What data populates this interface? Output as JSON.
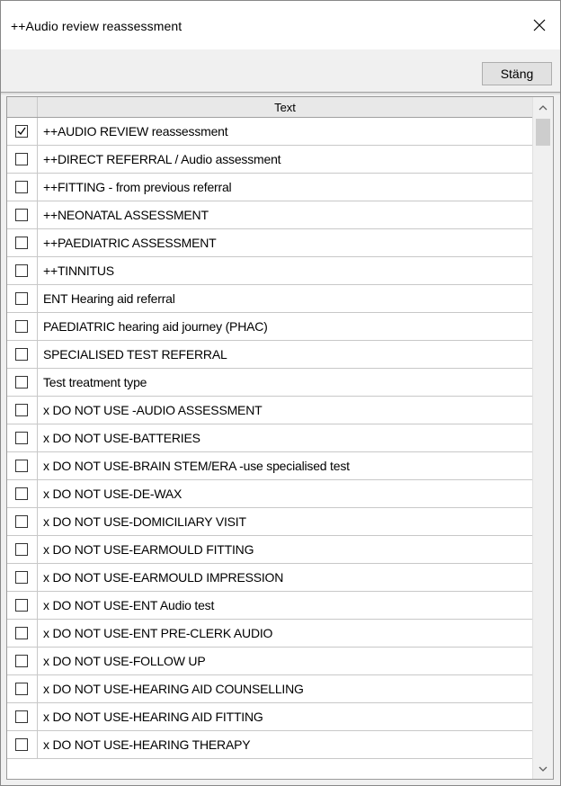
{
  "window": {
    "title": "++Audio review reassessment"
  },
  "toolbar": {
    "close_label": "Stäng"
  },
  "grid": {
    "column_header": "Text",
    "rows": [
      {
        "label": "++AUDIO REVIEW reassessment",
        "checked": true
      },
      {
        "label": "++DIRECT REFERRAL / Audio assessment",
        "checked": false
      },
      {
        "label": "++FITTING - from previous referral",
        "checked": false
      },
      {
        "label": "++NEONATAL ASSESSMENT",
        "checked": false
      },
      {
        "label": "++PAEDIATRIC ASSESSMENT",
        "checked": false
      },
      {
        "label": "++TINNITUS",
        "checked": false
      },
      {
        "label": "ENT Hearing aid referral",
        "checked": false
      },
      {
        "label": "PAEDIATRIC hearing aid journey (PHAC)",
        "checked": false
      },
      {
        "label": "SPECIALISED TEST REFERRAL",
        "checked": false
      },
      {
        "label": "Test treatment type",
        "checked": false
      },
      {
        "label": "x DO NOT USE -AUDIO ASSESSMENT",
        "checked": false
      },
      {
        "label": "x DO NOT USE-BATTERIES",
        "checked": false
      },
      {
        "label": "x DO NOT USE-BRAIN STEM/ERA -use specialised test",
        "checked": false
      },
      {
        "label": "x DO NOT USE-DE-WAX",
        "checked": false
      },
      {
        "label": "x DO NOT USE-DOMICILIARY VISIT",
        "checked": false
      },
      {
        "label": "x DO NOT USE-EARMOULD FITTING",
        "checked": false
      },
      {
        "label": "x DO NOT USE-EARMOULD IMPRESSION",
        "checked": false
      },
      {
        "label": "x DO NOT USE-ENT Audio test",
        "checked": false
      },
      {
        "label": "x DO NOT USE-ENT PRE-CLERK AUDIO",
        "checked": false
      },
      {
        "label": "x DO NOT USE-FOLLOW UP",
        "checked": false
      },
      {
        "label": "x DO NOT USE-HEARING AID COUNSELLING",
        "checked": false
      },
      {
        "label": "x DO NOT USE-HEARING AID FITTING",
        "checked": false
      },
      {
        "label": "x DO NOT USE-HEARING THERAPY",
        "checked": false
      }
    ]
  }
}
